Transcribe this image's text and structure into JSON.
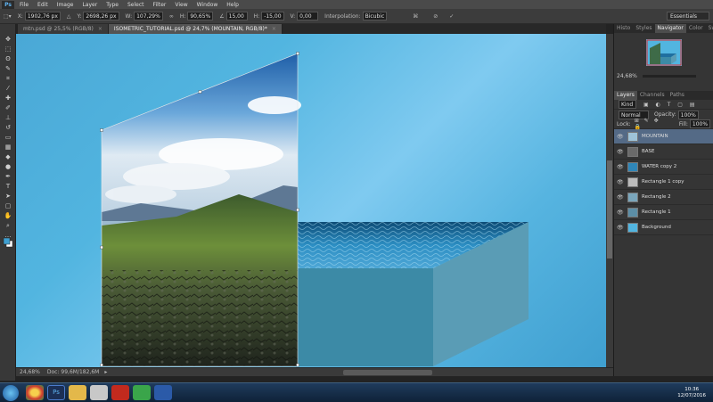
{
  "menu": {
    "logo": "Ps",
    "items": [
      "File",
      "Edit",
      "Image",
      "Layer",
      "Type",
      "Select",
      "Filter",
      "View",
      "Window",
      "Help"
    ]
  },
  "options": {
    "x_label": "X:",
    "x_value": "1902,76 px",
    "y_label": "Y:",
    "y_value": "2698,26 px",
    "w_label": "W:",
    "w_value": "107,29%",
    "h_label": "H:",
    "h_value": "90,65%",
    "angle_label": "∠",
    "angle_value": "15,00",
    "hskew_label": "H:",
    "hskew_value": "-15,00",
    "vskew_label": "V:",
    "vskew_value": "0,00",
    "interp_label": "Interpolation:",
    "interp_value": "Bicubic",
    "workspace": "Essentials"
  },
  "tabs": [
    {
      "label": "mtn.psd @ 25,5% (RGB/8)"
    },
    {
      "label": "ISOMETRIC_TUTORIAL.psd @ 24,7% (MOUNTAIN, RGB/8)*"
    }
  ],
  "status": {
    "zoom": "24,68%",
    "doc": "Doc: 99,6M/182,6M"
  },
  "panel": {
    "top_tabs": [
      "Histo",
      "Styles",
      "Navigator",
      "Color",
      "Swatch"
    ],
    "nav_zoom": "24,68%",
    "layer_tabs": [
      "Layers",
      "Channels",
      "Paths"
    ],
    "kind_label": "Kind",
    "blend_mode": "Normal",
    "opacity_label": "Opacity:",
    "opacity_value": "100%",
    "lock_label": "Lock:",
    "fill_label": "Fill:",
    "fill_value": "100%",
    "layers": [
      {
        "name": "MOUNTAIN",
        "selected": true,
        "visible": true,
        "thumb": "#9ec3d8"
      },
      {
        "name": "BASE",
        "selected": false,
        "visible": true,
        "thumb": "#6a6a6a"
      },
      {
        "name": "WATER copy 2",
        "selected": false,
        "visible": true,
        "thumb": "#2f86b8"
      },
      {
        "name": "Rectangle 1 copy",
        "selected": false,
        "visible": true,
        "thumb": "#bbbbbb"
      },
      {
        "name": "Rectangle 2",
        "selected": false,
        "visible": true,
        "thumb": "#7aa6bc"
      },
      {
        "name": "Rectangle 1",
        "selected": false,
        "visible": true,
        "thumb": "#5c8ea6"
      },
      {
        "name": "Background",
        "selected": false,
        "visible": true,
        "thumb": "#52b5e0"
      }
    ]
  },
  "taskbar": {
    "time": "10:36",
    "date": "12/07/2016"
  },
  "colors": {
    "accent": "#546a86",
    "canvas": "#52b5e0"
  }
}
